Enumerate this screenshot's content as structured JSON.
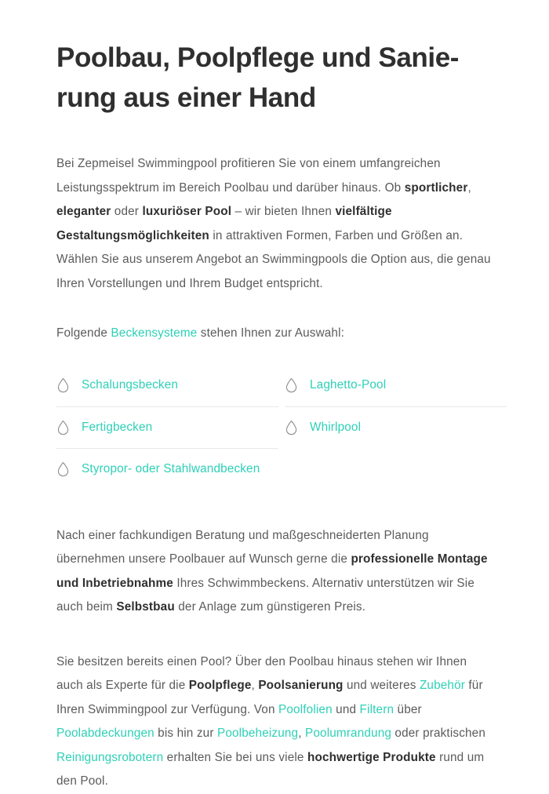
{
  "page": {
    "title": "Poolbau, Poolpflege und Sanie-rung aus einer Hand",
    "title_line1": "Poolbau, Poolpflege und Sanie-",
    "title_line2": "rung aus einer Hand"
  },
  "colors": {
    "link_teal": "#2ed0b7",
    "heading": "#2f2f2f",
    "body_text": "#5b5b5b",
    "divider": "#e8e8e8",
    "icon_stroke": "#8c8c8c",
    "background": "#ffffff"
  },
  "intro_paragraph": {
    "segments": [
      {
        "text": "Bei Zepmeisel Swimmingpool profitieren Sie von einem umfangreichen Leistungsspektrum im Bereich Poolbau und darüber hinaus. Ob ",
        "style": "normal"
      },
      {
        "text": "sportlicher",
        "style": "bold"
      },
      {
        "text": ", ",
        "style": "normal"
      },
      {
        "text": "eleganter",
        "style": "bold"
      },
      {
        "text": " oder ",
        "style": "normal"
      },
      {
        "text": "luxuriöser Pool",
        "style": "bold"
      },
      {
        "text": " – wir bieten Ihnen ",
        "style": "normal"
      },
      {
        "text": "vielfältige Gestaltungsmöglichkeiten",
        "style": "bold"
      },
      {
        "text": " in attraktiven Formen, Farben und Größen an. Wählen Sie aus unserem Angebot an Swimmingpools die Option aus, die genau Ihren Vorstellungen und Ihrem Budget entspricht.",
        "style": "normal"
      }
    ]
  },
  "lead_in": {
    "before": "Folgende ",
    "link": "Beckensysteme",
    "after": " stehen Ihnen zur Auswahl:"
  },
  "systems": {
    "icon": "water-droplet-icon",
    "items": [
      {
        "label": "Schalungsbecken",
        "column": "left",
        "row": 1,
        "rule_above": false
      },
      {
        "label": "Laghetto-Pool",
        "column": "right",
        "row": 1,
        "rule_above": false
      },
      {
        "label": "Fertigbecken",
        "column": "left",
        "row": 2,
        "rule_above": true
      },
      {
        "label": "Whirlpool",
        "column": "right",
        "row": 2,
        "rule_above": true
      },
      {
        "label": "Styropor- oder Stahlwandbecken",
        "column": "left",
        "row": 3,
        "rule_above": true
      }
    ]
  },
  "after_paragraph": {
    "segments": [
      {
        "text": "Nach einer fachkundigen Beratung und maßgeschneiderten Planung übernehmen unsere Poolbauer auf Wunsch gerne die ",
        "style": "normal"
      },
      {
        "text": "professionelle Montage und Inbetriebnahme",
        "style": "bold"
      },
      {
        "text": " Ihres Schwimmbeckens. Alternativ unterstützen wir Sie auch beim ",
        "style": "normal"
      },
      {
        "text": "Selbstbau",
        "style": "bold"
      },
      {
        "text": " der Anlage zum günstigeren Preis.",
        "style": "normal"
      }
    ]
  },
  "final_paragraph": {
    "segments": [
      {
        "text": "Sie besitzen bereits einen Pool? Über den Poolbau hinaus stehen wir Ihnen auch als Experte für die ",
        "style": "normal"
      },
      {
        "text": "Poolpflege",
        "style": "bold"
      },
      {
        "text": ", ",
        "style": "normal"
      },
      {
        "text": "Poolsanierung",
        "style": "bold"
      },
      {
        "text": " und weiteres ",
        "style": "normal"
      },
      {
        "text": "Zubehör",
        "style": "link"
      },
      {
        "text": " für Ihren Swimmingpool zur Verfügung. Von ",
        "style": "normal"
      },
      {
        "text": "Poolfolien",
        "style": "link"
      },
      {
        "text": " und ",
        "style": "normal"
      },
      {
        "text": "Filtern",
        "style": "link"
      },
      {
        "text": " über ",
        "style": "normal"
      },
      {
        "text": "Poolabdeckungen",
        "style": "link"
      },
      {
        "text": " bis hin zur ",
        "style": "normal"
      },
      {
        "text": "Poolbeheizung",
        "style": "link"
      },
      {
        "text": ", ",
        "style": "normal"
      },
      {
        "text": "Poolumrandung",
        "style": "link"
      },
      {
        "text": " oder praktischen ",
        "style": "normal"
      },
      {
        "text": "Reinigungsrobotern",
        "style": "link"
      },
      {
        "text": " erhalten Sie bei uns viele ",
        "style": "normal"
      },
      {
        "text": "hochwertige Produkte",
        "style": "bold"
      },
      {
        "text": " rund um den Pool.",
        "style": "normal"
      }
    ]
  }
}
